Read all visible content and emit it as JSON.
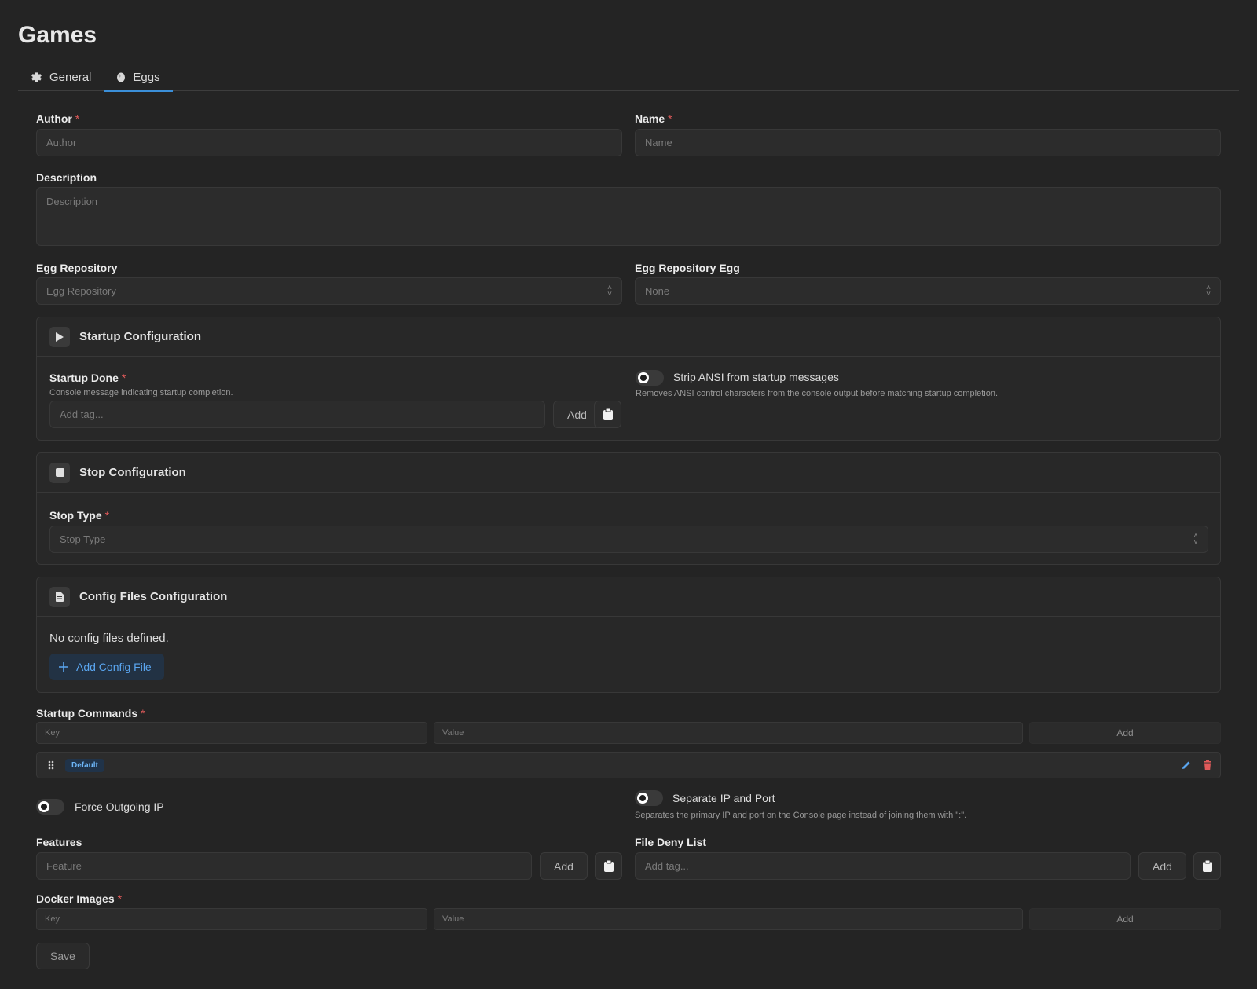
{
  "page": {
    "title": "Games"
  },
  "tabs": [
    {
      "label": "General",
      "icon": "gear-icon"
    },
    {
      "label": "Eggs",
      "icon": "egg-icon"
    }
  ],
  "author": {
    "label": "Author",
    "placeholder": "Author",
    "required": "*"
  },
  "name": {
    "label": "Name",
    "placeholder": "Name",
    "required": "*"
  },
  "description": {
    "label": "Description",
    "placeholder": "Description"
  },
  "egg_repository": {
    "label": "Egg Repository",
    "placeholder": "Egg Repository"
  },
  "egg_repository_egg": {
    "label": "Egg Repository Egg",
    "placeholder": "None"
  },
  "startup": {
    "title": "Startup Configuration",
    "done_label": "Startup Done",
    "done_required": "*",
    "done_hint": "Console message indicating startup completion.",
    "tag_placeholder": "Add tag...",
    "add_label": "Add",
    "strip_label": "Strip ANSI from startup messages",
    "strip_hint": "Removes ANSI control characters from the console output before matching startup completion."
  },
  "stop": {
    "title": "Stop Configuration",
    "type_label": "Stop Type",
    "type_required": "*",
    "type_placeholder": "Stop Type"
  },
  "config_files": {
    "title": "Config Files Configuration",
    "empty_text": "No config files defined.",
    "add_label": "Add Config File"
  },
  "startup_commands": {
    "label": "Startup Commands",
    "required": "*",
    "key_placeholder": "Key",
    "value_placeholder": "Value",
    "add_label": "Add",
    "row_badge": "Default"
  },
  "force_outgoing_ip": {
    "label": "Force Outgoing IP"
  },
  "separate_ip_port": {
    "label": "Separate IP and Port",
    "hint": "Separates the primary IP and port on the Console page instead of joining them with \":\"."
  },
  "features": {
    "label": "Features",
    "placeholder": "Feature",
    "add_label": "Add"
  },
  "file_deny_list": {
    "label": "File Deny List",
    "placeholder": "Add tag...",
    "add_label": "Add"
  },
  "docker_images": {
    "label": "Docker Images",
    "required": "*",
    "key_placeholder": "Key",
    "value_placeholder": "Value",
    "add_label": "Add"
  },
  "save_label": "Save",
  "colors": {
    "accent": "#3b8fd9",
    "danger": "#e05a5a",
    "background": "#242424"
  }
}
